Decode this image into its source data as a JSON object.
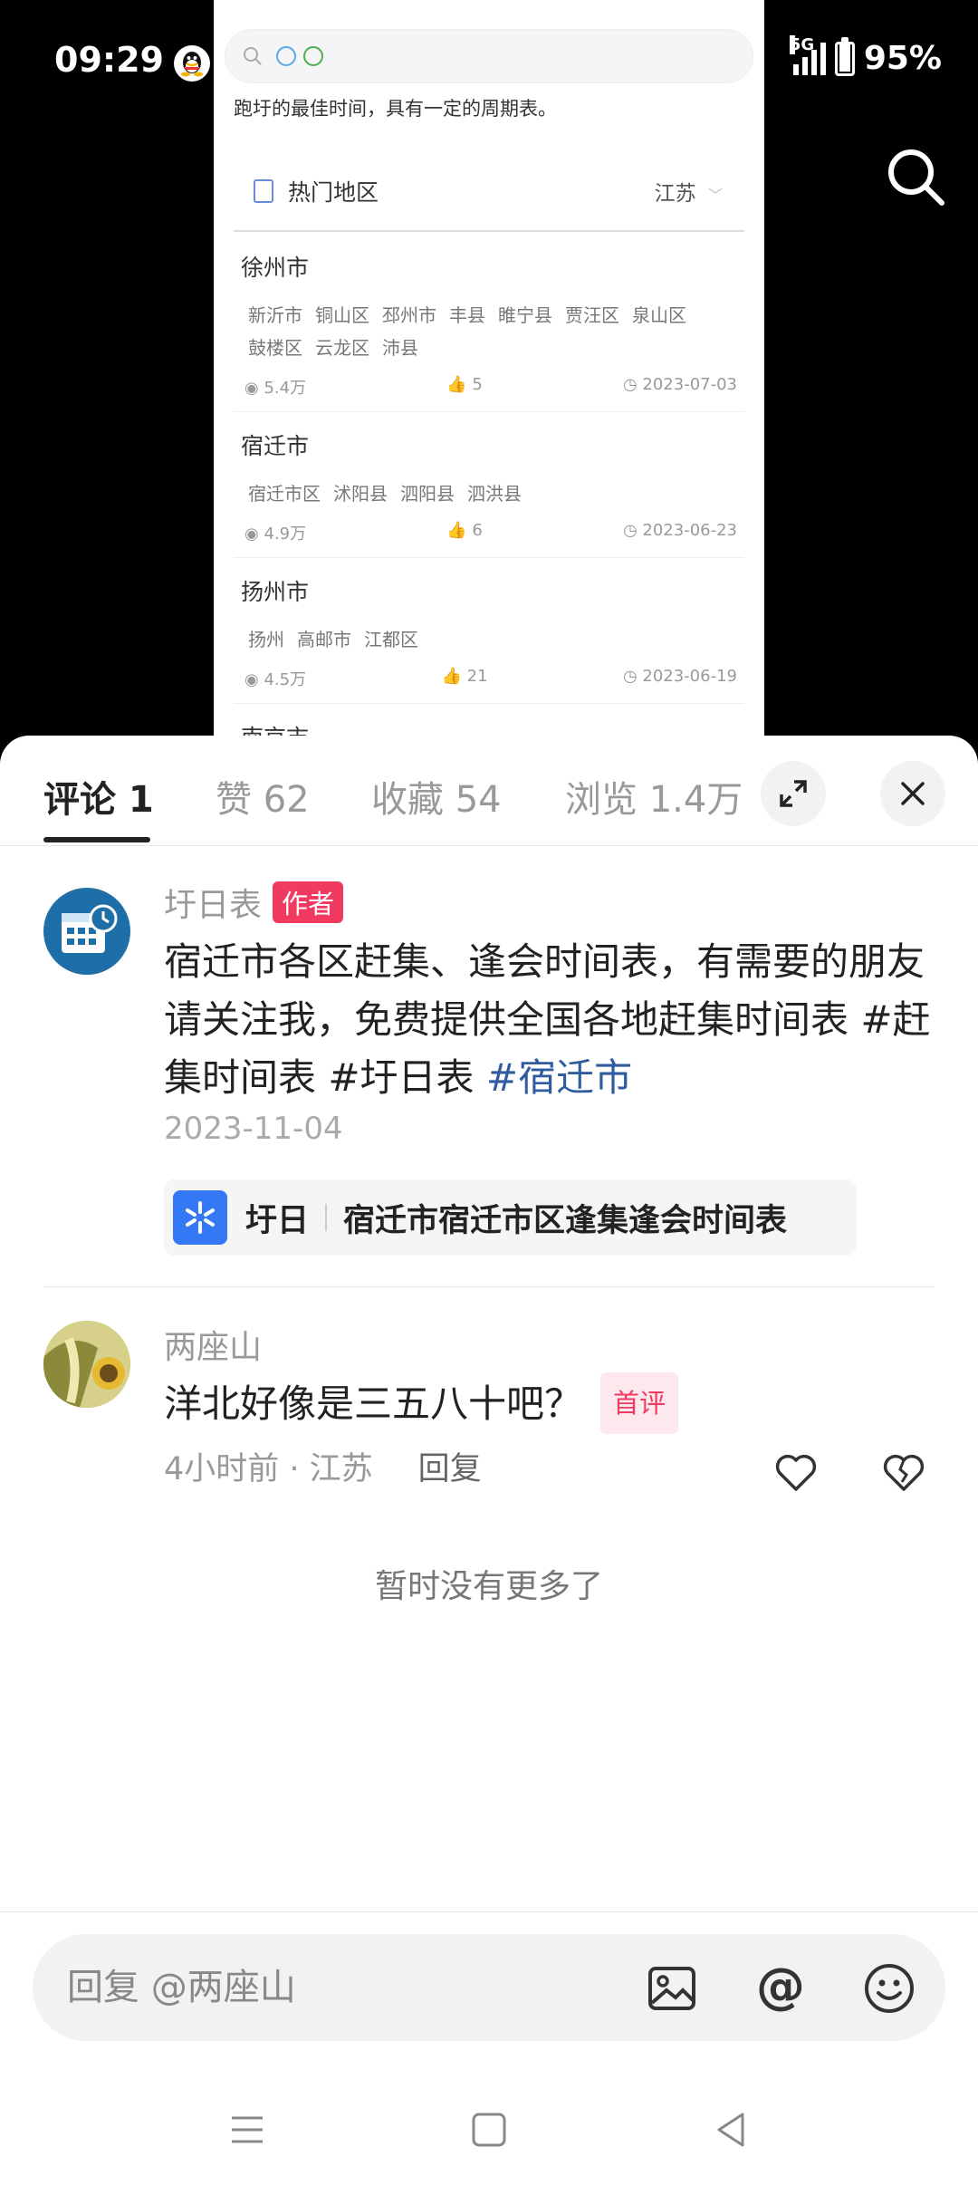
{
  "status_bar": {
    "time": "09:29",
    "network": "5G",
    "battery": "95%",
    "battery_level": 0.95
  },
  "preview": {
    "description": "跑圩的最佳时间，具有一定的周期表。",
    "hot_regions_title": "热门地区",
    "region_selector": "江苏",
    "cities": [
      {
        "name": "徐州市",
        "districts": [
          "新沂市",
          "铜山区",
          "邳州市",
          "丰县",
          "睢宁县",
          "贾汪区",
          "泉山区",
          "鼓楼区",
          "云龙区",
          "沛县"
        ],
        "views": "5.4万",
        "likes": "5",
        "date": "2023-07-03"
      },
      {
        "name": "宿迁市",
        "districts": [
          "宿迁市区",
          "沭阳县",
          "泗阳县",
          "泗洪县"
        ],
        "views": "4.9万",
        "likes": "6",
        "date": "2023-06-23"
      },
      {
        "name": "扬州市",
        "districts": [
          "扬州",
          "高邮市",
          "江都区"
        ],
        "views": "4.5万",
        "likes": "21",
        "date": "2023-06-19"
      },
      {
        "name": "南京市",
        "districts": [],
        "views": "",
        "likes": "",
        "date": ""
      }
    ]
  },
  "tabs": {
    "comments": "评论 1",
    "likes": "赞 62",
    "favorites": "收藏 54",
    "views": "浏览 1.4万"
  },
  "author_comment": {
    "user": "圩日表",
    "badge": "作者",
    "text": "宿迁市各区赶集、逢会时间表，有需要的朋友请关注我，免费提供全国各地赶集时间表 #赶集时间表 #圩日表 ",
    "hashtag_link": "#宿迁市",
    "date": "2023-11-04",
    "mini_program": {
      "name": "圩日",
      "title": "宿迁市宿迁市区逢集逢会时间表"
    }
  },
  "reply_comment": {
    "user": "两座山",
    "text": "洋北好像是三五八十吧？",
    "badge": "首评",
    "time_location": "4小时前 · 江苏",
    "reply_label": "回复"
  },
  "no_more": "暂时没有更多了",
  "reply_bar": {
    "placeholder": "回复 @两座山"
  },
  "colors": {
    "accent_red": "#f03a5f",
    "hashtag_blue": "#2e5c9e",
    "mini_program_blue": "#3478f6"
  }
}
